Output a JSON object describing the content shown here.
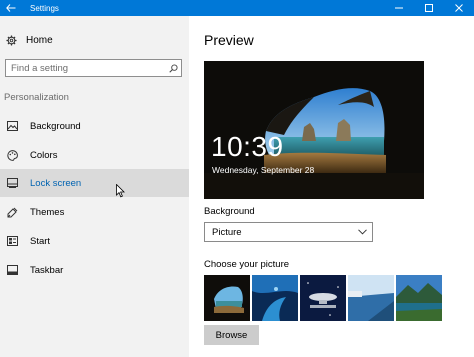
{
  "window": {
    "title": "Settings",
    "accent": "#0078d7"
  },
  "sidebar": {
    "home_label": "Home",
    "search_placeholder": "Find a setting",
    "section_label": "Personalization",
    "items": [
      {
        "label": "Background",
        "icon": "picture-icon",
        "selected": false
      },
      {
        "label": "Colors",
        "icon": "palette-icon",
        "selected": false
      },
      {
        "label": "Lock screen",
        "icon": "lock-screen-icon",
        "selected": true
      },
      {
        "label": "Themes",
        "icon": "brush-icon",
        "selected": false
      },
      {
        "label": "Start",
        "icon": "start-icon",
        "selected": false
      },
      {
        "label": "Taskbar",
        "icon": "taskbar-icon",
        "selected": false
      }
    ]
  },
  "main": {
    "preview_title": "Preview",
    "preview_time": "10:39",
    "preview_date": "Wednesday, September 28",
    "background_label": "Background",
    "background_value": "Picture",
    "choose_label": "Choose your picture",
    "browse_label": "Browse"
  }
}
